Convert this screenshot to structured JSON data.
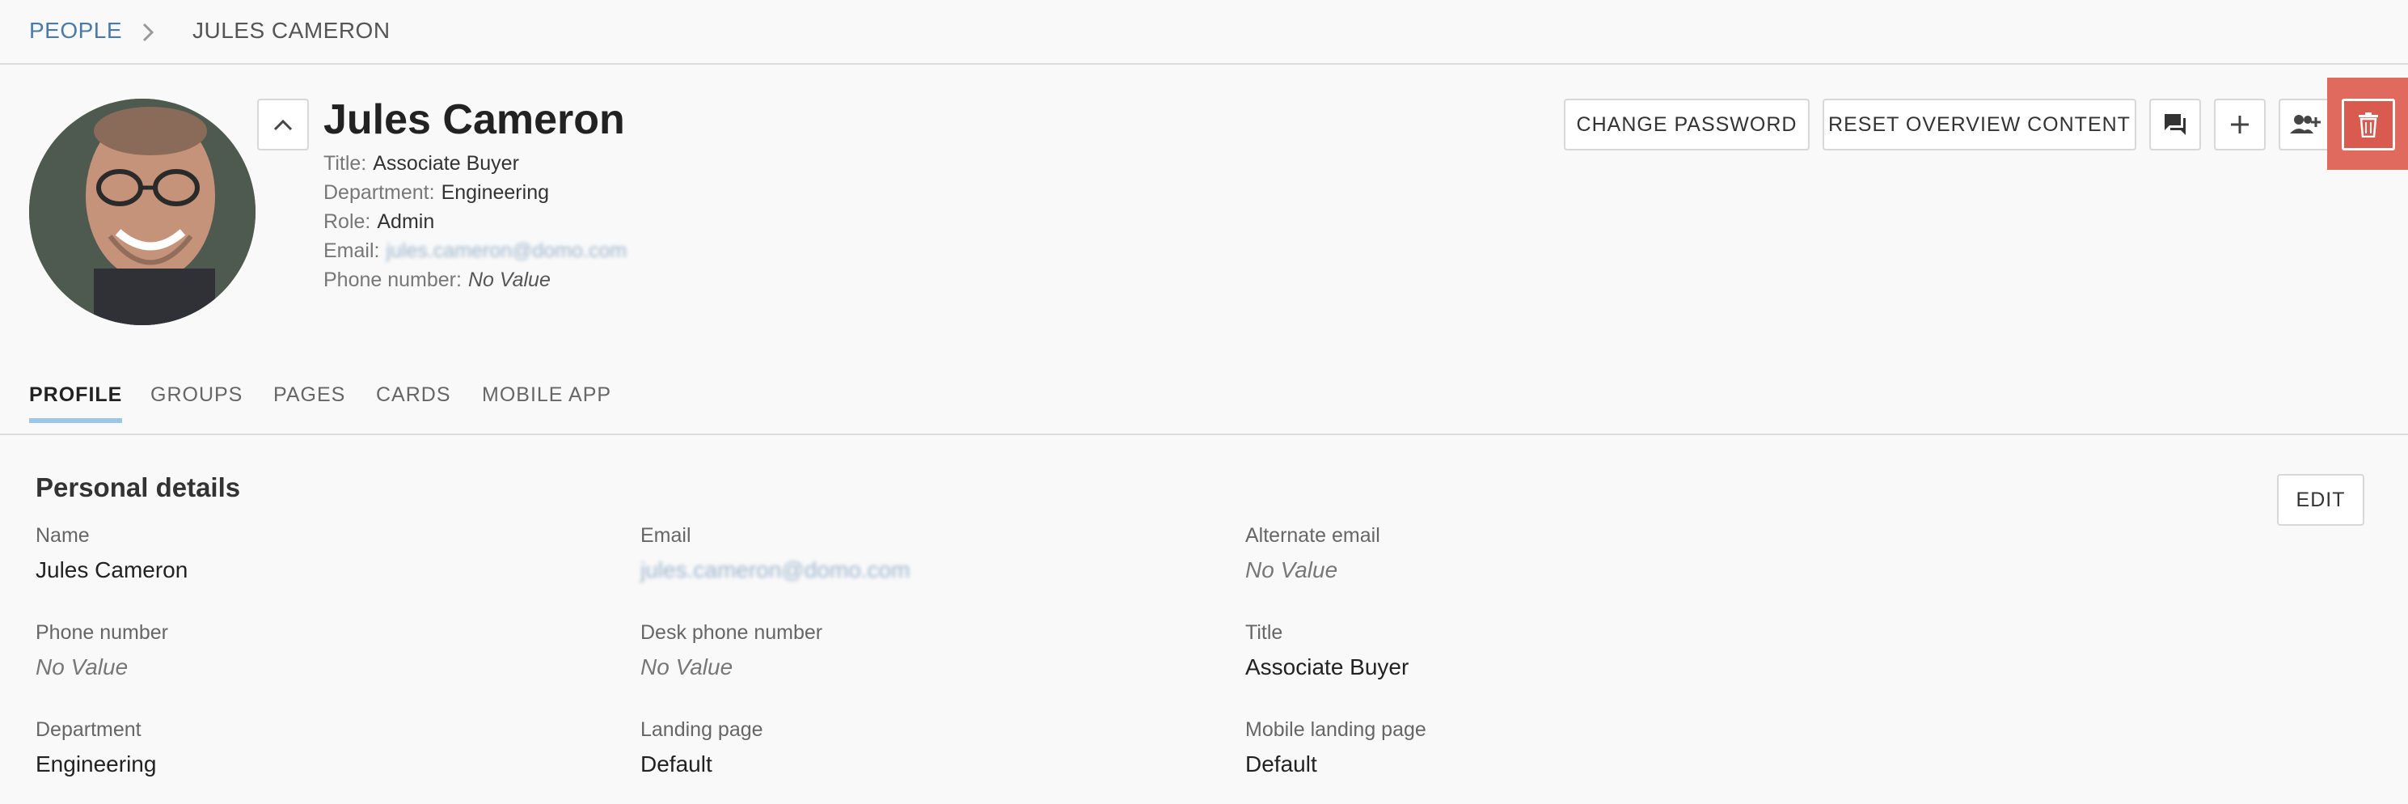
{
  "breadcrumb": {
    "root": "PEOPLE",
    "current": "JULES CAMERON"
  },
  "profile": {
    "name": "Jules Cameron",
    "meta": [
      {
        "key": "Title:",
        "value": "Associate Buyer",
        "style": "normal"
      },
      {
        "key": "Department:",
        "value": "Engineering",
        "style": "normal"
      },
      {
        "key": "Role:",
        "value": "Admin",
        "style": "normal"
      },
      {
        "key": "Email:",
        "value": "jules.cameron@domo.com",
        "style": "blur"
      },
      {
        "key": "Phone number:",
        "value": "No Value",
        "style": "italic"
      }
    ]
  },
  "actions": {
    "change_password": "CHANGE PASSWORD",
    "reset_overview": "RESET OVERVIEW CONTENT",
    "icons": [
      "chat-icon",
      "plus-icon",
      "add-user-icon",
      "trash-icon"
    ]
  },
  "tabs": [
    {
      "label": "PROFILE",
      "active": true
    },
    {
      "label": "GROUPS",
      "active": false
    },
    {
      "label": "PAGES",
      "active": false
    },
    {
      "label": "CARDS",
      "active": false
    },
    {
      "label": "MOBILE APP",
      "active": false
    }
  ],
  "personal": {
    "title": "Personal details",
    "edit_label": "EDIT",
    "fields": [
      {
        "label": "Name",
        "value": "Jules Cameron",
        "style": "normal"
      },
      {
        "label": "Email",
        "value": "jules.cameron@domo.com",
        "style": "blur"
      },
      {
        "label": "Alternate email",
        "value": "No Value",
        "style": "italic"
      },
      {
        "label": "Phone number",
        "value": "No Value",
        "style": "italic"
      },
      {
        "label": "Desk phone number",
        "value": "No Value",
        "style": "italic"
      },
      {
        "label": "Title",
        "value": "Associate Buyer",
        "style": "normal"
      },
      {
        "label": "Department",
        "value": "Engineering",
        "style": "normal"
      },
      {
        "label": "Landing page",
        "value": "Default",
        "style": "normal"
      },
      {
        "label": "Mobile landing page",
        "value": "Default",
        "style": "normal"
      }
    ]
  },
  "colors": {
    "link": "#4a7ba8",
    "tab_underline": "#9cc6e6",
    "delete": "#d95b50",
    "highlight": "#e06a5e"
  }
}
